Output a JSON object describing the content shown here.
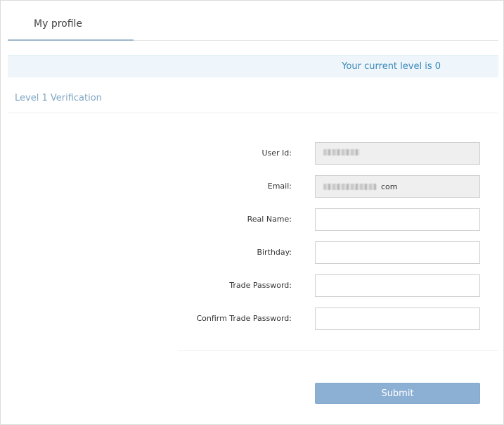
{
  "tabs": {
    "active_label": "My profile"
  },
  "level_banner": {
    "text": "Your current level is 0"
  },
  "section": {
    "title": "Level 1 Verification"
  },
  "form": {
    "user_id": {
      "label": "User Id:",
      "value": ""
    },
    "email": {
      "label": "Email:",
      "value_suffix": "com"
    },
    "real_name": {
      "label": "Real Name:",
      "value": ""
    },
    "birthday": {
      "label": "Birthday:",
      "value": ""
    },
    "trade_password": {
      "label": "Trade Password:",
      "value": ""
    },
    "confirm_trade_password": {
      "label": "Confirm Trade Password:",
      "value": ""
    },
    "submit_label": "Submit"
  },
  "colors": {
    "accent": "#3a87b8",
    "section_title": "#7fa6c3",
    "banner_background": "#eef6fb",
    "submit_background": "#8cb0d4",
    "readonly_field_background": "#efefef"
  }
}
